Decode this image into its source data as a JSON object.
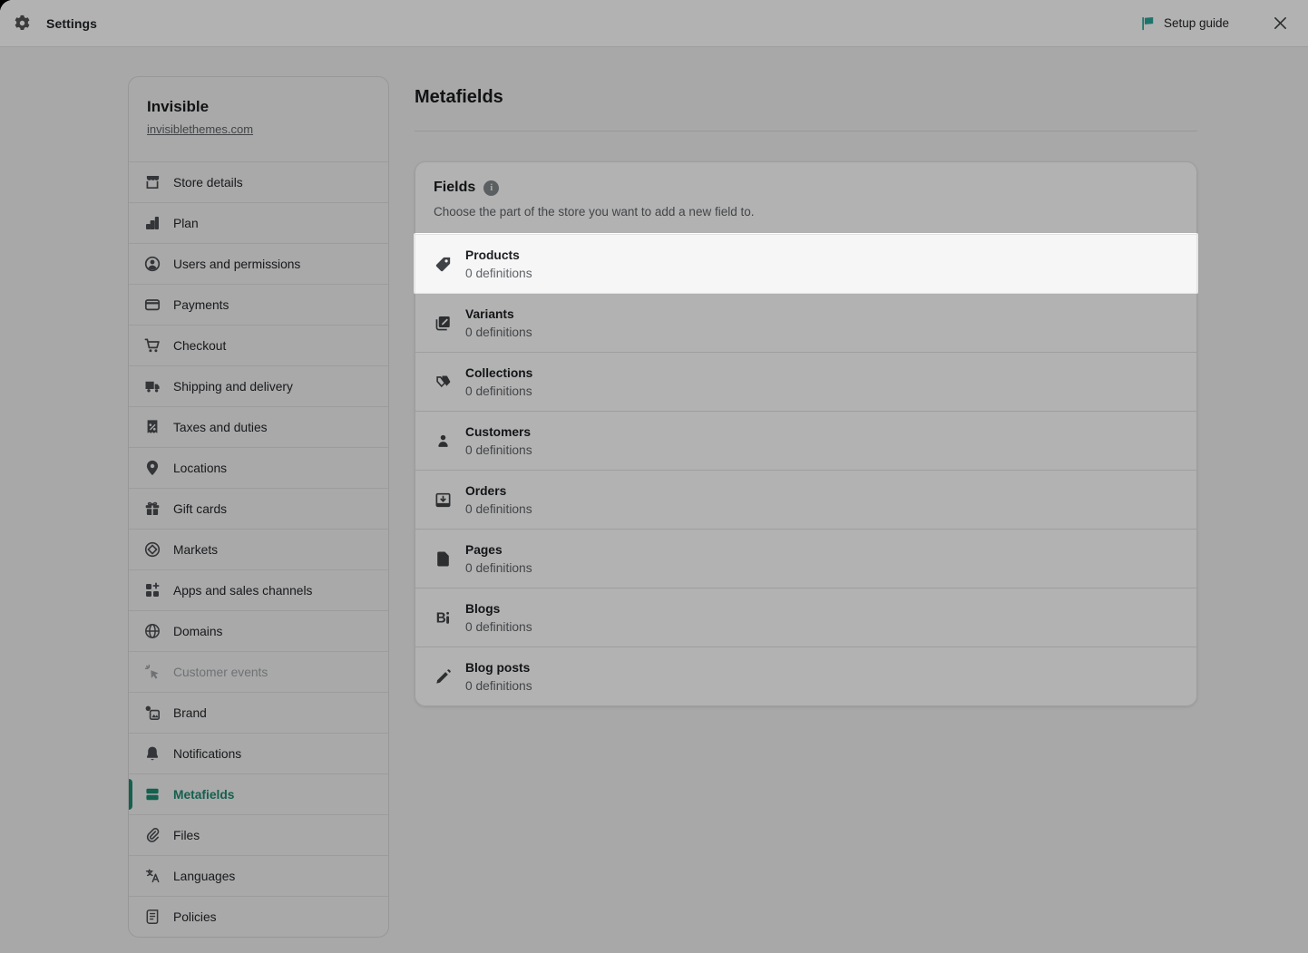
{
  "topbar": {
    "title": "Settings",
    "gear_icon": "gear-icon",
    "setup_guide_label": "Setup guide",
    "flag_icon": "flag-icon",
    "close_icon": "close-icon"
  },
  "sidebar": {
    "store_name": "Invisible",
    "store_domain": "invisiblethemes.com",
    "items": [
      {
        "label": "Store details",
        "icon": "store-icon"
      },
      {
        "label": "Plan",
        "icon": "plan-icon"
      },
      {
        "label": "Users and permissions",
        "icon": "users-icon"
      },
      {
        "label": "Payments",
        "icon": "payments-icon"
      },
      {
        "label": "Checkout",
        "icon": "checkout-icon"
      },
      {
        "label": "Shipping and delivery",
        "icon": "shipping-icon"
      },
      {
        "label": "Taxes and duties",
        "icon": "taxes-icon"
      },
      {
        "label": "Locations",
        "icon": "locations-icon"
      },
      {
        "label": "Gift cards",
        "icon": "gift-cards-icon"
      },
      {
        "label": "Markets",
        "icon": "markets-icon"
      },
      {
        "label": "Apps and sales channels",
        "icon": "apps-icon"
      },
      {
        "label": "Domains",
        "icon": "domains-icon"
      },
      {
        "label": "Customer events",
        "icon": "customer-events-icon",
        "disabled": true
      },
      {
        "label": "Brand",
        "icon": "brand-icon"
      },
      {
        "label": "Notifications",
        "icon": "notifications-icon"
      },
      {
        "label": "Metafields",
        "icon": "metafields-icon",
        "active": true
      },
      {
        "label": "Files",
        "icon": "files-icon"
      },
      {
        "label": "Languages",
        "icon": "languages-icon"
      },
      {
        "label": "Policies",
        "icon": "policies-icon"
      }
    ]
  },
  "main": {
    "page_title": "Metafields",
    "card": {
      "title": "Fields",
      "info_icon": "info-icon",
      "description": "Choose the part of the store you want to add a new field to.",
      "rows": [
        {
          "label": "Products",
          "count": "0 definitions",
          "icon": "products-icon",
          "highlighted": true
        },
        {
          "label": "Variants",
          "count": "0 definitions",
          "icon": "variants-icon"
        },
        {
          "label": "Collections",
          "count": "0 definitions",
          "icon": "collections-icon"
        },
        {
          "label": "Customers",
          "count": "0 definitions",
          "icon": "customers-icon"
        },
        {
          "label": "Orders",
          "count": "0 definitions",
          "icon": "orders-icon"
        },
        {
          "label": "Pages",
          "count": "0 definitions",
          "icon": "pages-icon"
        },
        {
          "label": "Blogs",
          "count": "0 definitions",
          "icon": "blogs-icon"
        },
        {
          "label": "Blog posts",
          "count": "0 definitions",
          "icon": "blog-posts-icon"
        }
      ]
    }
  },
  "colors": {
    "accent_teal": "#1f8a70",
    "flag_teal": "#2aa79b",
    "overlay_dim": "rgba(0,0,0,0.30)",
    "highlight_row_bg": "#f6f6f6"
  }
}
